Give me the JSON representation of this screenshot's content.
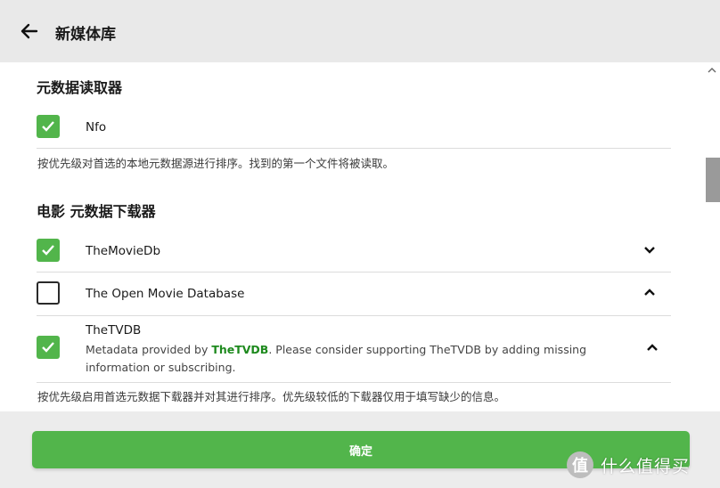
{
  "header": {
    "title": "新媒体库"
  },
  "metadata_readers": {
    "title": "元数据读取器",
    "items": [
      {
        "label": "Nfo",
        "checked": true
      }
    ],
    "hint": "按优先级对首选的本地元数据源进行排序。找到的第一个文件将被读取。"
  },
  "movie_downloaders": {
    "title": "电影 元数据下载器",
    "items": [
      {
        "label": "TheMovieDb",
        "checked": true,
        "chevron": "down"
      },
      {
        "label": "The Open Movie Database",
        "checked": false,
        "chevron": "up"
      },
      {
        "label": "TheTVDB",
        "checked": true,
        "chevron": "up",
        "desc_prefix": "Metadata provided by ",
        "desc_link": "TheTVDB",
        "desc_suffix": ". Please consider supporting TheTVDB by adding missing information or subscribing."
      }
    ],
    "hint": "按优先级启用首选元数据下载器并对其进行排序。优先级较低的下载器仅用于填写缺少的信息。"
  },
  "footer": {
    "confirm_label": "确定"
  },
  "watermark": {
    "text": "什么值得买",
    "logo_glyph": "值"
  },
  "colors": {
    "accent": "#52b54b",
    "link": "#1e8a1e",
    "header_bg": "#e9e9e9"
  }
}
